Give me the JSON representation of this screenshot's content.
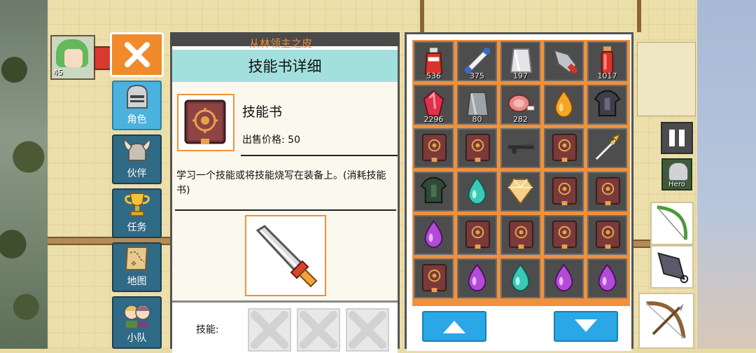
{
  "background": {
    "quest_item_name": "从林领主之皮",
    "hero_level": "45"
  },
  "close_button": {
    "icon": "close-x-icon"
  },
  "tabs": [
    {
      "label": "角色",
      "icon": "knight-helmet-icon",
      "active": true
    },
    {
      "label": "伙伴",
      "icon": "viking-helmet-icon",
      "active": false
    },
    {
      "label": "任务",
      "icon": "trophy-icon",
      "active": false
    },
    {
      "label": "地图",
      "icon": "map-scroll-icon",
      "active": false
    },
    {
      "label": "小队",
      "icon": "party-heroes-icon",
      "active": false
    }
  ],
  "detail": {
    "title": "技能书详细",
    "item_name": "技能书",
    "price_text": "出售价格: 50",
    "description": "学习一个技能或将技能烧写在装备上。(消耗技能书)",
    "skill_label": "技能:"
  },
  "inventory": {
    "items": [
      {
        "icon": "red-potion-icon",
        "count": "536"
      },
      {
        "icon": "scroll-icon",
        "count": "375"
      },
      {
        "icon": "silver-ingot-icon",
        "count": "197"
      },
      {
        "icon": "drill-bit-icon",
        "count": ""
      },
      {
        "icon": "red-vial-icon",
        "count": "1017"
      },
      {
        "icon": "ruby-gem-icon",
        "count": "2296"
      },
      {
        "icon": "iron-ingot-icon",
        "count": "80"
      },
      {
        "icon": "meat-icon",
        "count": "282"
      },
      {
        "icon": "amber-drop-icon",
        "count": ""
      },
      {
        "icon": "dark-armor-icon",
        "count": ""
      },
      {
        "icon": "skill-book-icon",
        "count": ""
      },
      {
        "icon": "skill-book-icon",
        "count": ""
      },
      {
        "icon": "rifle-icon",
        "count": ""
      },
      {
        "icon": "skill-book-icon",
        "count": ""
      },
      {
        "icon": "golden-spear-icon",
        "count": ""
      },
      {
        "icon": "green-armor-icon",
        "count": ""
      },
      {
        "icon": "teal-drop-icon",
        "count": ""
      },
      {
        "icon": "topaz-crystal-icon",
        "count": ""
      },
      {
        "icon": "skill-book-icon",
        "count": ""
      },
      {
        "icon": "skill-book-icon",
        "count": ""
      },
      {
        "icon": "purple-drop-icon",
        "count": ""
      },
      {
        "icon": "skill-book-icon",
        "count": ""
      },
      {
        "icon": "skill-book-icon",
        "count": ""
      },
      {
        "icon": "skill-book-icon",
        "count": ""
      },
      {
        "icon": "skill-book-icon",
        "count": ""
      },
      {
        "icon": "skill-book-icon",
        "count": ""
      },
      {
        "icon": "purple-drop-icon",
        "count": ""
      },
      {
        "icon": "teal-drop-icon",
        "count": ""
      },
      {
        "icon": "purple-drop-icon",
        "count": ""
      },
      {
        "icon": "purple-drop-icon",
        "count": ""
      }
    ]
  },
  "hud": {
    "hero_button_label": "Hero"
  },
  "colors": {
    "accent_orange": "#f0913a",
    "header_teal": "#a2e0de",
    "tab_active": "#4bb2e0",
    "arrow_blue": "#2aa7e6"
  }
}
